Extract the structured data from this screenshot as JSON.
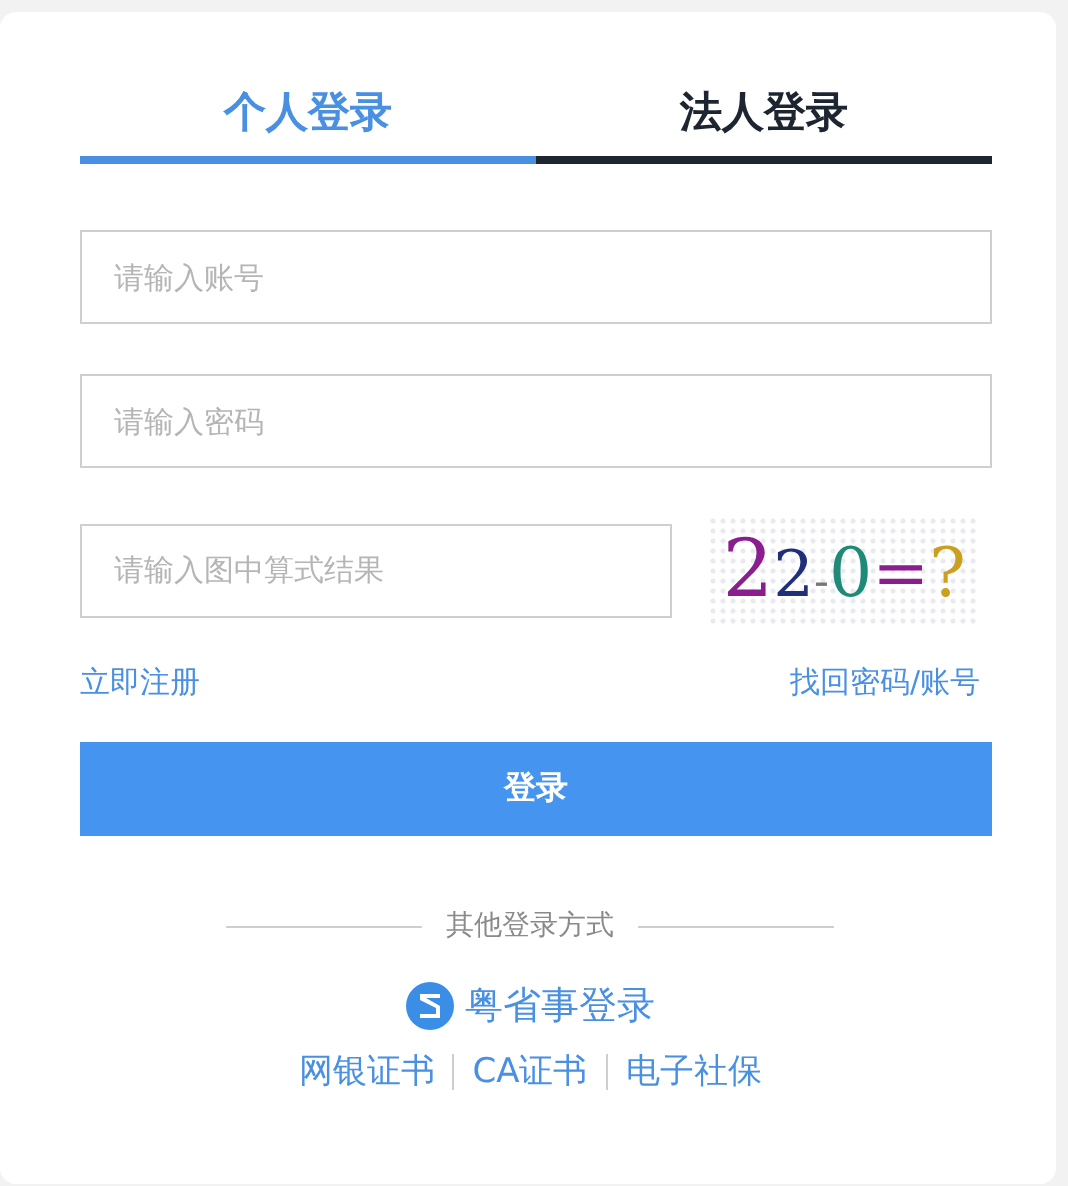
{
  "tabs": [
    {
      "label": "个人登录",
      "selected": true
    },
    {
      "label": "法人登录",
      "selected": false
    }
  ],
  "fields": [
    {
      "placeholder": "请输入账号"
    },
    {
      "placeholder": "请输入密码"
    }
  ],
  "captcha": {
    "placeholder": "请输入图中算式结果",
    "image_text": "22-0=?"
  },
  "links": {
    "register": "立即注册",
    "recover": "找回密码/账号"
  },
  "login_button": "登录",
  "other_methods": {
    "title": "其他登录方式",
    "app_login": "粤省事登录",
    "options": [
      "网银证书",
      "CA证书",
      "电子社保"
    ]
  }
}
